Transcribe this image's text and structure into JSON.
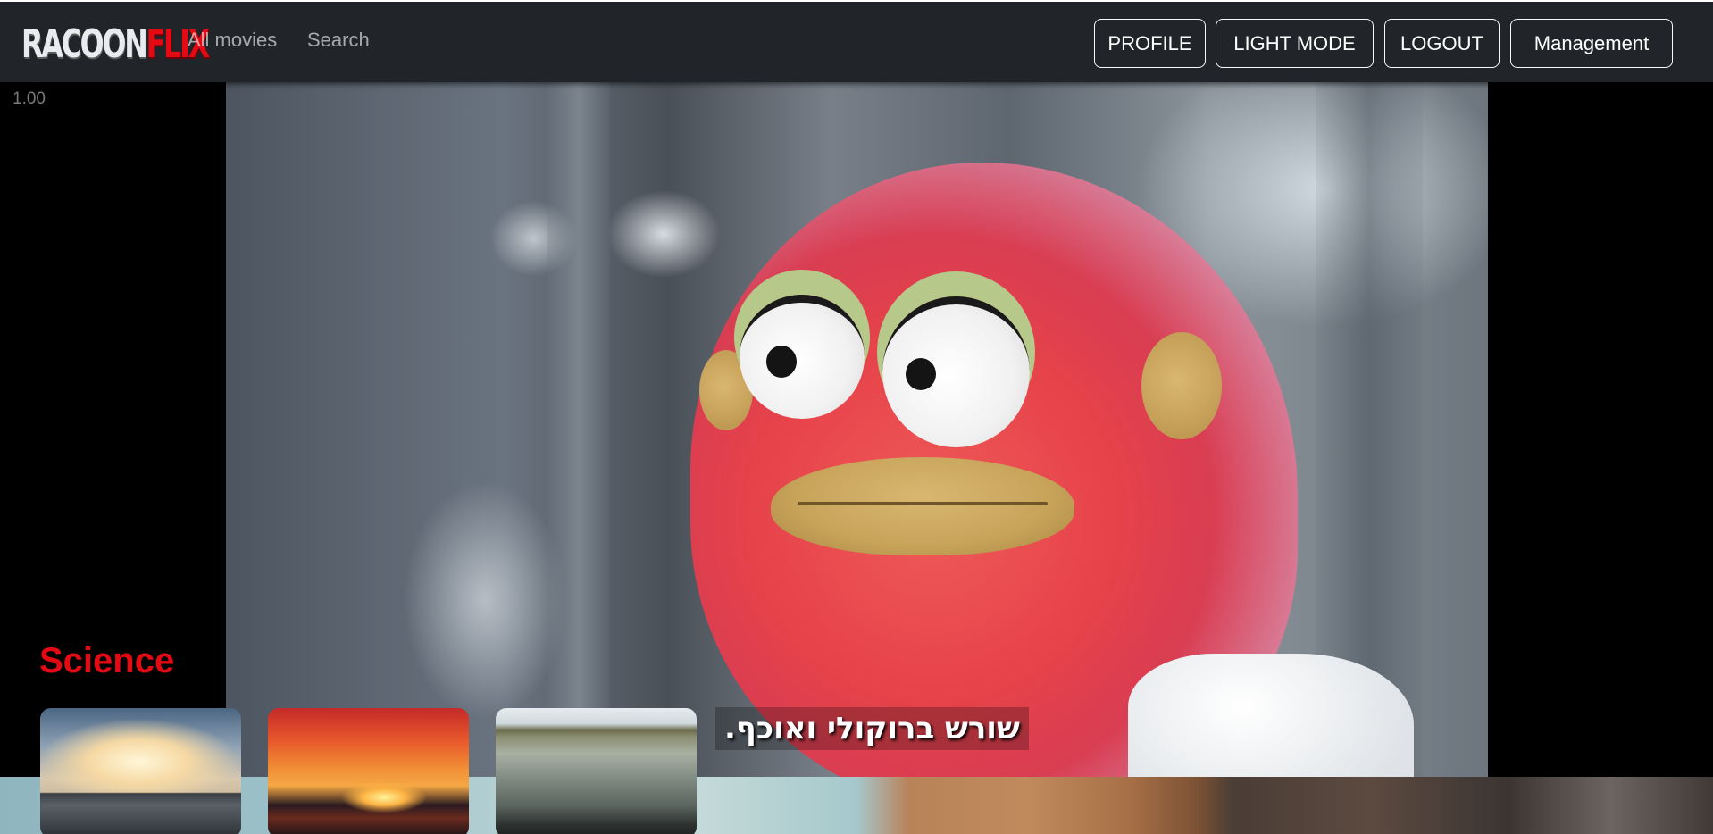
{
  "navbar": {
    "logo": {
      "part1": "RACOON",
      "part2": "FLIX"
    },
    "links": [
      "All movies",
      "Search"
    ],
    "buttons": [
      "PROFILE",
      "LIGHT MODE",
      "LOGOUT",
      "Management"
    ]
  },
  "player": {
    "playback_rate": "1.00",
    "subtitle": "שורש ברוקולי ואוכף."
  },
  "category": {
    "title": "Science",
    "thumbnails": [
      "city-skyline-thumbnail",
      "sunset-sea-thumbnail",
      "misty-field-thumbnail"
    ]
  },
  "colors": {
    "navbar_bg": "#212529",
    "brand_red": "#e50914",
    "page_bg": "#000000"
  }
}
